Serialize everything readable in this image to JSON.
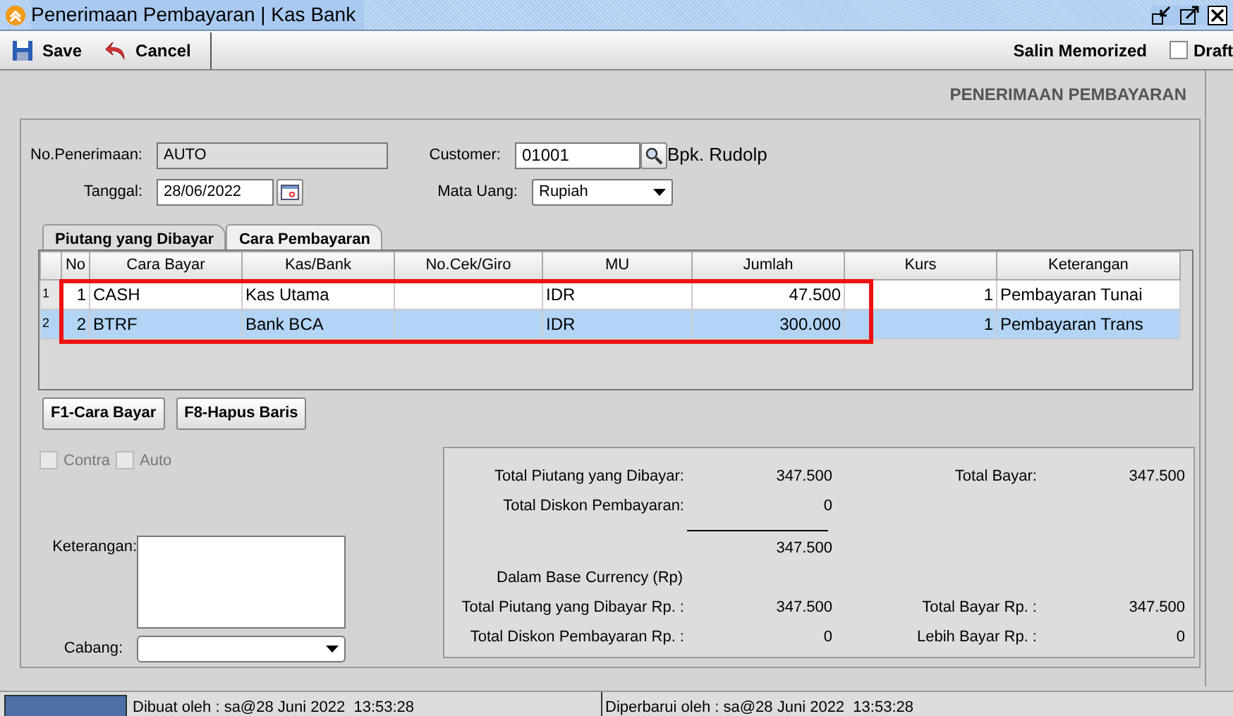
{
  "window": {
    "title": "Penerimaan Pembayaran | Kas Bank"
  },
  "toolbar": {
    "buttons": [
      {
        "kind": "save",
        "label": "Save"
      },
      {
        "kind": "cancel",
        "label": "Cancel"
      }
    ],
    "salin": "Salin Memorized",
    "draft": {
      "label": "Draft",
      "checked": false
    }
  },
  "heading": "PENERIMAAN PEMBAYARAN",
  "form": {
    "no_penerimaan": {
      "label": "No.Penerimaan:",
      "value": "AUTO"
    },
    "tanggal": {
      "label": "Tanggal:",
      "value": "28/06/2022"
    },
    "customer": {
      "label": "Customer:",
      "value": "01001",
      "name": "Bpk. Rudolp"
    },
    "mata_uang": {
      "label": "Mata Uang:",
      "value": "Rupiah"
    }
  },
  "tabs": [
    {
      "label": "Piutang yang Dibayar",
      "selected": false
    },
    {
      "label": "Cara Pembayaran",
      "selected": true
    }
  ],
  "table": {
    "columns": [
      "No",
      "Cara Bayar",
      "Kas/Bank",
      "No.Cek/Giro",
      "MU",
      "Jumlah",
      "Kurs",
      "Keterangan"
    ],
    "rows": [
      {
        "row_header": "1",
        "selected": false,
        "cells": [
          "1",
          "CASH",
          "Kas Utama",
          "",
          "IDR",
          "47.500",
          "1",
          "Pembayaran Tunai"
        ]
      },
      {
        "row_header": "2",
        "selected": true,
        "cells": [
          "2",
          "BTRF",
          "Bank BCA",
          "",
          "IDR",
          "300.000",
          "1",
          "Pembayaran Trans"
        ]
      }
    ]
  },
  "highlight_box": {
    "color": "#ee1111"
  },
  "grid_buttons": [
    "F1-Cara Bayar",
    "F8-Hapus Baris"
  ],
  "options": [
    {
      "label": "Contra",
      "checked": false,
      "disabled": true
    },
    {
      "label": "Auto",
      "checked": false,
      "disabled": true
    }
  ],
  "keterangan": {
    "label": "Keterangan:"
  },
  "cabang": {
    "label": "Cabang:"
  },
  "totals": {
    "left": [
      {
        "label": "Total Piutang yang Dibayar:",
        "value": "347.500"
      },
      {
        "label": "Total Diskon Pembayaran:",
        "value": "0"
      }
    ],
    "subtotal": "347.500",
    "total_bayar": {
      "label": "Total Bayar:",
      "value": "347.500"
    },
    "base_heading": "Dalam Base Currency (Rp)",
    "base": [
      {
        "label": "Total Piutang yang Dibayar Rp. :",
        "value": "347.500",
        "label2": "Total Bayar Rp. :",
        "value2": "347.500"
      },
      {
        "label": "Total Diskon Pembayaran Rp. :",
        "value": "0",
        "label2": "Lebih Bayar Rp. :",
        "value2": "0"
      }
    ]
  },
  "status_bar": [
    "Dibuat oleh : sa@28 Juni 2022  13:53:28",
    "Diperbarui oleh : sa@28 Juni 2022  13:53:28"
  ]
}
